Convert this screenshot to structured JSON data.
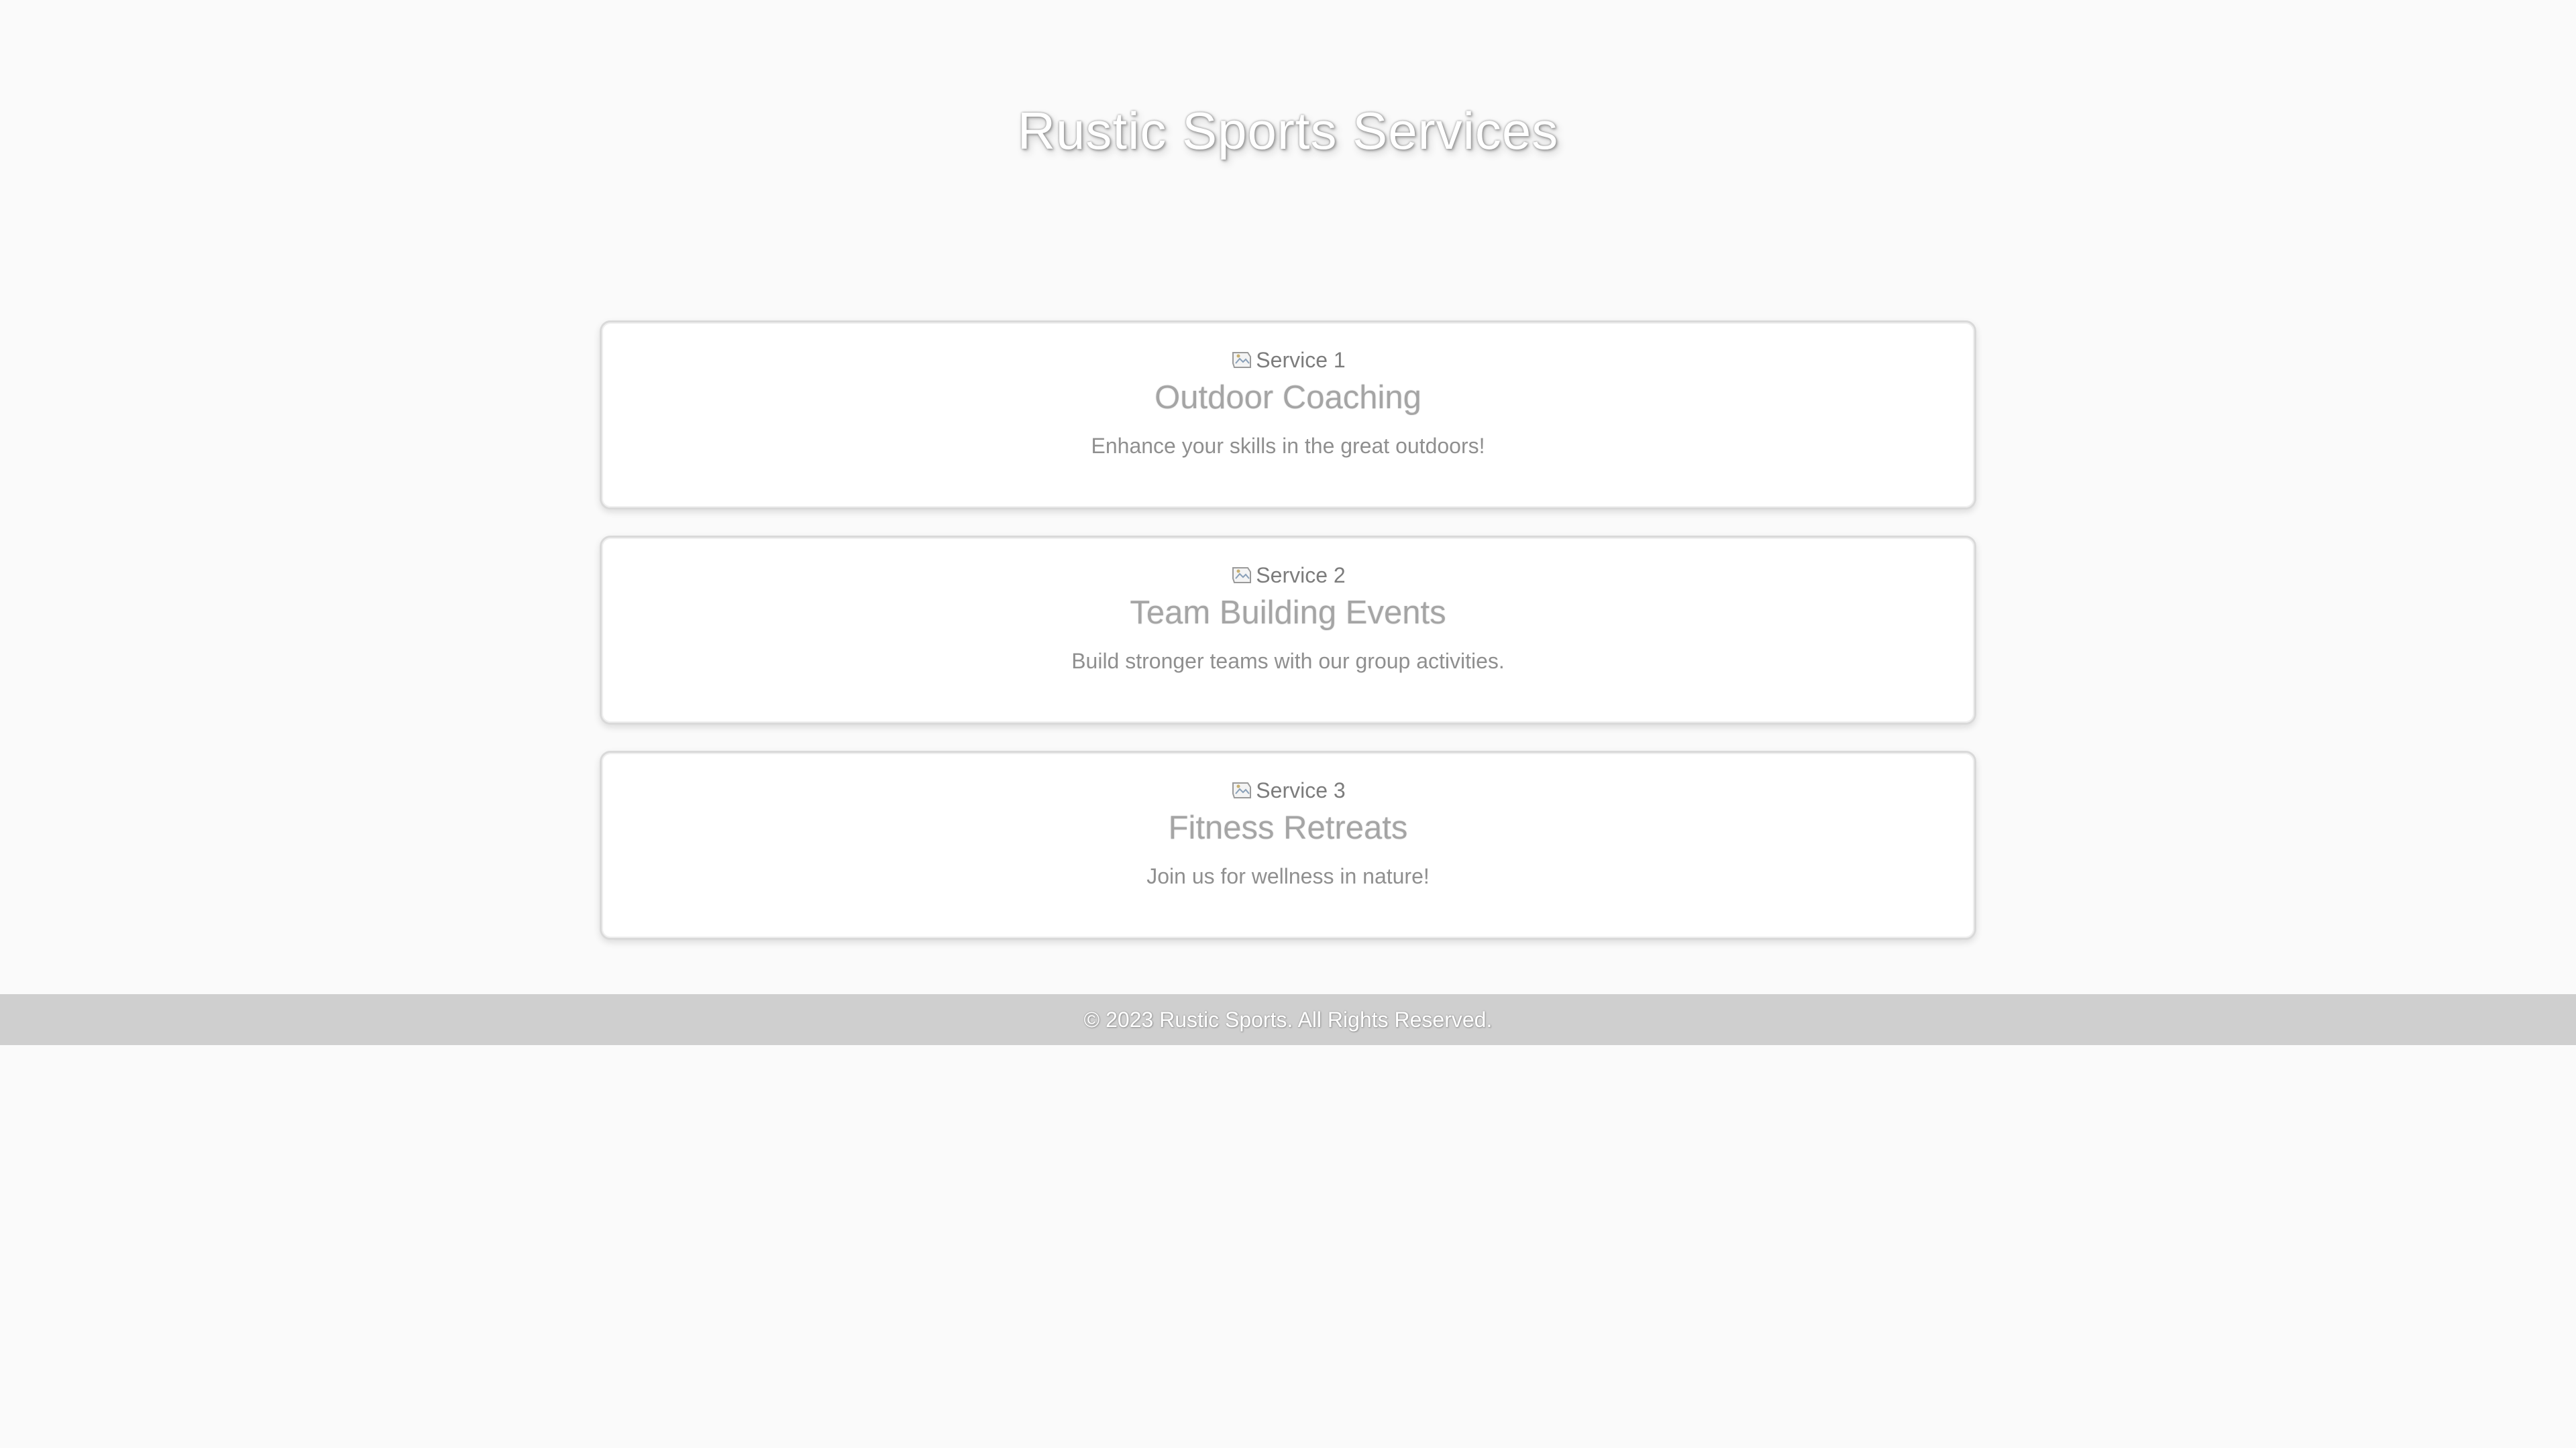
{
  "header": {
    "title": "Rustic Sports Services"
  },
  "services": [
    {
      "image_alt": "Service 1",
      "title": "Outdoor Coaching",
      "description": "Enhance your skills in the great outdoors!"
    },
    {
      "image_alt": "Service 2",
      "title": "Team Building Events",
      "description": "Build stronger teams with our group activities."
    },
    {
      "image_alt": "Service 3",
      "title": "Fitness Retreats",
      "description": "Join us for wellness in nature!"
    }
  ],
  "footer": {
    "text": "© 2023 Rustic Sports. All Rights Reserved."
  },
  "icons": {
    "broken_image": "broken-image-icon"
  },
  "colors": {
    "background": "#fafafa",
    "card_background": "#ffffff",
    "footer_background": "#cfcfcf"
  }
}
